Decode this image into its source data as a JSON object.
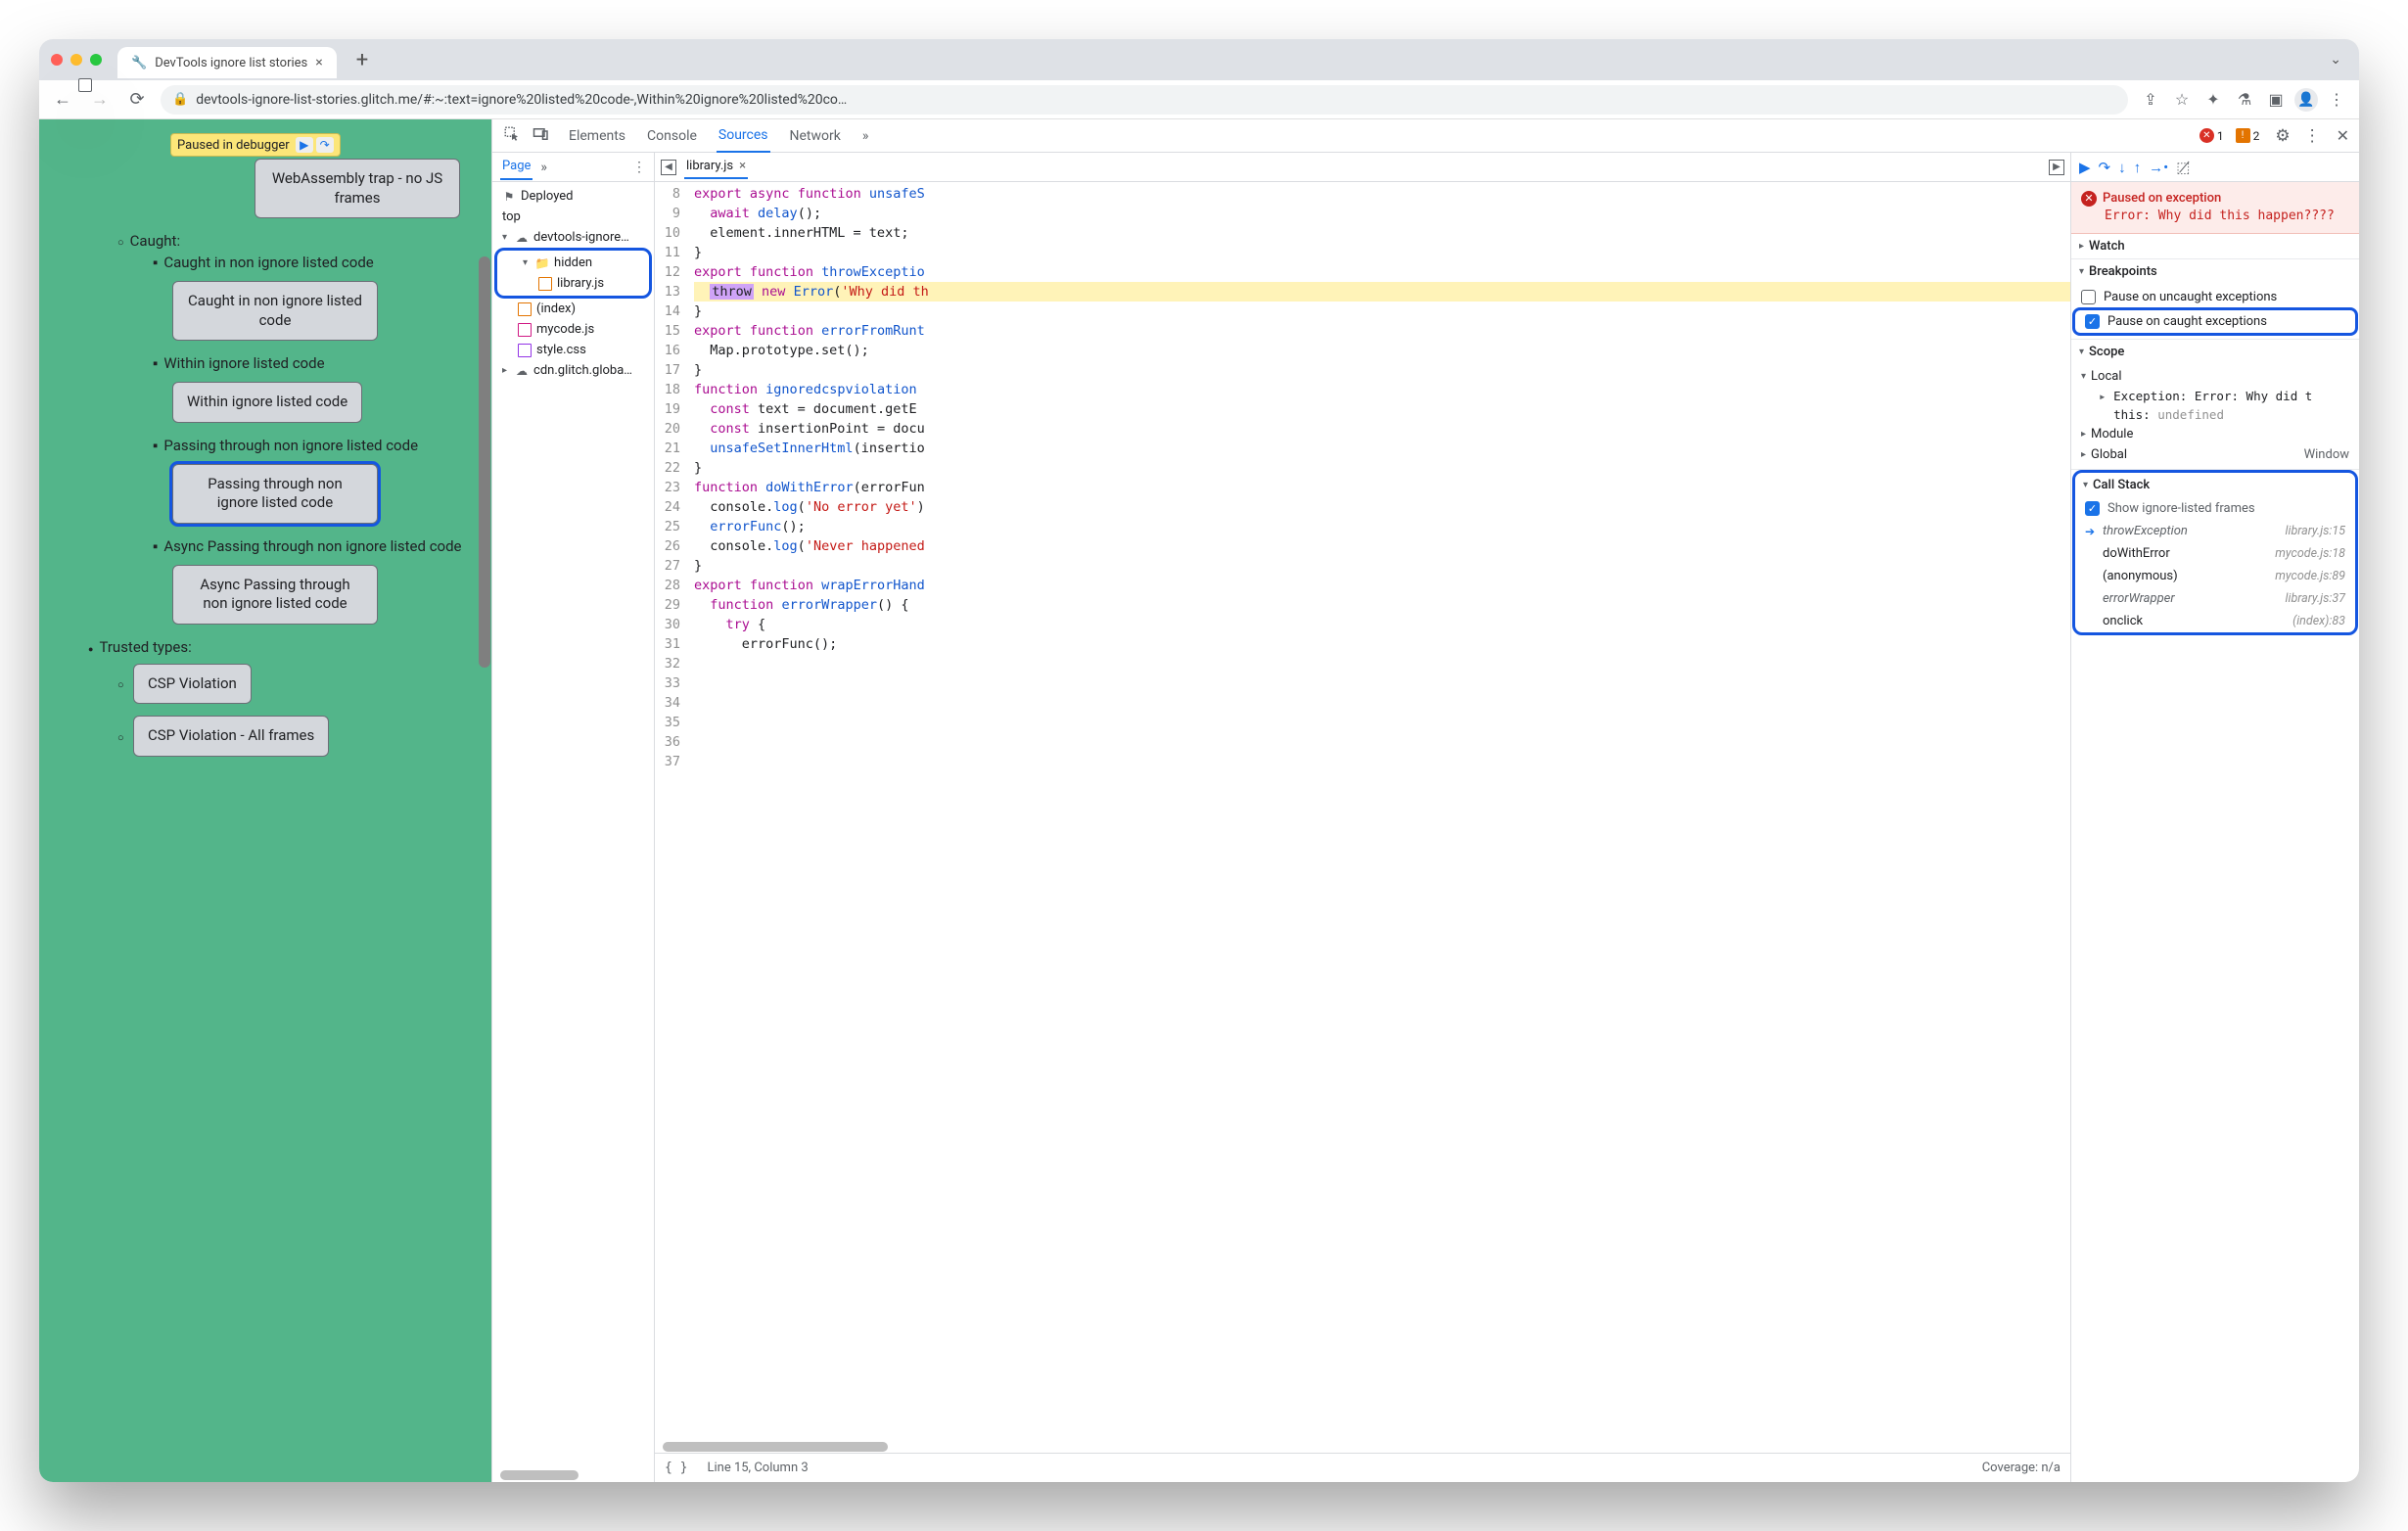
{
  "chrome": {
    "traffic": [
      "#ff5f57",
      "#febc2e",
      "#28c840"
    ],
    "tab_title": "DevTools ignore list stories",
    "url": "devtools-ignore-list-stories.glitch.me/#:~:text=ignore%20listed%20code-,Within%20ignore%20listed%20co…",
    "nav_icons": {
      "back": "←",
      "forward": "→",
      "reload": "⟳"
    }
  },
  "page": {
    "paused_chip": "Paused in debugger",
    "items": [
      {
        "type": "btn",
        "text": "WebAssembly trap - no JS frames"
      },
      {
        "type": "sub",
        "text": "Caught:"
      },
      {
        "type": "li",
        "text": "Caught in non ignore listed code"
      },
      {
        "type": "btn",
        "text": "Caught in non ignore listed code"
      },
      {
        "type": "li",
        "text": "Within ignore listed code"
      },
      {
        "type": "btn",
        "text": "Within ignore listed code"
      },
      {
        "type": "li",
        "text": "Passing through non ignore listed code"
      },
      {
        "type": "btn-hl",
        "text": "Passing through non ignore listed code"
      },
      {
        "type": "li",
        "text": "Async Passing through non ignore listed code"
      },
      {
        "type": "btn",
        "text": "Async Passing through non ignore listed code"
      },
      {
        "type": "disc",
        "text": "Trusted types:"
      },
      {
        "type": "circ",
        "text": ""
      },
      {
        "type": "btn2",
        "text": "CSP Violation"
      },
      {
        "type": "circ",
        "text": ""
      },
      {
        "type": "btn2",
        "text": "CSP Violation - All frames"
      }
    ]
  },
  "devtools": {
    "tabs": [
      "Elements",
      "Console",
      "Sources",
      "Network"
    ],
    "active_tab": "Sources",
    "errors": 1,
    "warnings": 2,
    "navigator": {
      "tab": "Page",
      "tree": {
        "deployed": "Deployed",
        "top": "top",
        "origin": "devtools-ignore…",
        "folder": "hidden",
        "file1": "library.js",
        "file2": "(index)",
        "file3": "mycode.js",
        "file4": "style.css",
        "cdn": "cdn.glitch.globa…"
      }
    },
    "editor": {
      "filename": "library.js",
      "lines": [
        {
          "n": 8,
          "h": "<span class='kw'>export</span> <span class='kw'>async</span> <span class='kw'>function</span> <span class='fn'>unsafeS</span>"
        },
        {
          "n": 9,
          "h": "  <span class='kw'>await</span> <span class='fn'>delay</span>();"
        },
        {
          "n": 10,
          "h": "  element.innerHTML = text;"
        },
        {
          "n": 11,
          "h": "}"
        },
        {
          "n": 12,
          "h": ""
        },
        {
          "n": 13,
          "h": ""
        },
        {
          "n": 14,
          "h": "<span class='kw'>export</span> <span class='kw'>function</span> <span class='fn'>throwExceptio</span>"
        },
        {
          "n": 15,
          "hl": true,
          "h": "  <span class='throw'>throw</span> <span class='kw'>new</span> <span class='fn'>Error</span>(<span class='str'>'Why did th</span>"
        },
        {
          "n": 16,
          "h": "}"
        },
        {
          "n": 17,
          "h": ""
        },
        {
          "n": 18,
          "h": "<span class='kw'>export</span> <span class='kw'>function</span> <span class='fn'>errorFromRunt</span>"
        },
        {
          "n": 19,
          "h": "  Map.prototype.set();"
        },
        {
          "n": 20,
          "h": "}"
        },
        {
          "n": 21,
          "h": ""
        },
        {
          "n": 22,
          "h": "<span class='kw'>function</span> <span class='fn'>ignoredcspviolation</span>"
        },
        {
          "n": 23,
          "h": "  <span class='kw'>const</span> text = document.getE"
        },
        {
          "n": 24,
          "h": "  <span class='kw'>const</span> insertionPoint = docu"
        },
        {
          "n": 25,
          "h": "  <span class='fn'>unsafeSetInnerHtml</span>(insertio"
        },
        {
          "n": 26,
          "h": "}"
        },
        {
          "n": 27,
          "h": ""
        },
        {
          "n": 28,
          "h": "<span class='kw'>function</span> <span class='fn'>doWithError</span>(errorFun"
        },
        {
          "n": 29,
          "h": "  console.<span class='fn'>log</span>(<span class='str'>'No error yet'</span>)"
        },
        {
          "n": 30,
          "h": "  <span class='fn'>errorFunc</span>();"
        },
        {
          "n": 31,
          "h": "  console.<span class='fn'>log</span>(<span class='str'>'Never happened</span>"
        },
        {
          "n": 32,
          "h": "}"
        },
        {
          "n": 33,
          "h": ""
        },
        {
          "n": 34,
          "h": "<span class='kw'>export</span> <span class='kw'>function</span> <span class='fn'>wrapErrorHand</span>"
        },
        {
          "n": 35,
          "h": "  <span class='kw'>function</span> <span class='fn'>errorWrapper</span>() {"
        },
        {
          "n": 36,
          "h": "    <span class='kw'>try</span> {"
        },
        {
          "n": 37,
          "h": "      errorFunc();"
        }
      ],
      "status_line": "Line 15, Column 3",
      "coverage": "Coverage: n/a"
    },
    "debugger": {
      "paused_title": "Paused on exception",
      "paused_msg": "Error: Why did this happen????",
      "sections": {
        "watch": "Watch",
        "breakpoints": "Breakpoints",
        "bp_uncaught": "Pause on uncaught exceptions",
        "bp_caught": "Pause on caught exceptions",
        "scope": "Scope",
        "scope_items": {
          "local": "Local",
          "exc": "Exception",
          "exc_val": "Error: Why did t",
          "this": "this",
          "this_val": "undefined",
          "module": "Module",
          "global": "Global",
          "global_val": "Window"
        },
        "callstack": "Call Stack",
        "show_ignored": "Show ignore-listed frames",
        "stack": [
          {
            "fn": "throwException",
            "loc": "library.js:15",
            "muted": true,
            "current": true
          },
          {
            "fn": "doWithError",
            "loc": "mycode.js:18"
          },
          {
            "fn": "(anonymous)",
            "loc": "mycode.js:89"
          },
          {
            "fn": "errorWrapper",
            "loc": "library.js:37",
            "muted": true
          },
          {
            "fn": "onclick",
            "loc": "(index):83"
          }
        ]
      }
    }
  }
}
